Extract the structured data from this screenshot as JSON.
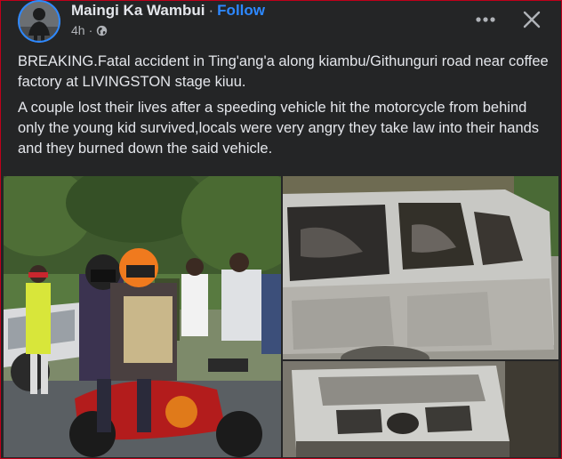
{
  "post": {
    "author": "Maingi Ka Wambui",
    "separator": "·",
    "follow_label": "Follow",
    "time": "4h",
    "paragraphs": [
      "BREAKING.Fatal accident in Ting'ang'a along kiambu/Githunguri road near coffee factory at LIVINGSTON stage kiuu.",
      "A couple lost their lives after a speeding vehicle hit the motorcycle from behind only the young kid survived,locals were very angry they take law into their hands and they burned down the said vehicle."
    ]
  },
  "icons": {
    "privacy": "globe-icon",
    "more": "more-horizontal-icon",
    "close": "close-icon"
  },
  "colors": {
    "background": "#242526",
    "text": "#e4e6eb",
    "secondary_text": "#b0b3b8",
    "link": "#2d88ff",
    "frame_border": "#c0001a"
  }
}
